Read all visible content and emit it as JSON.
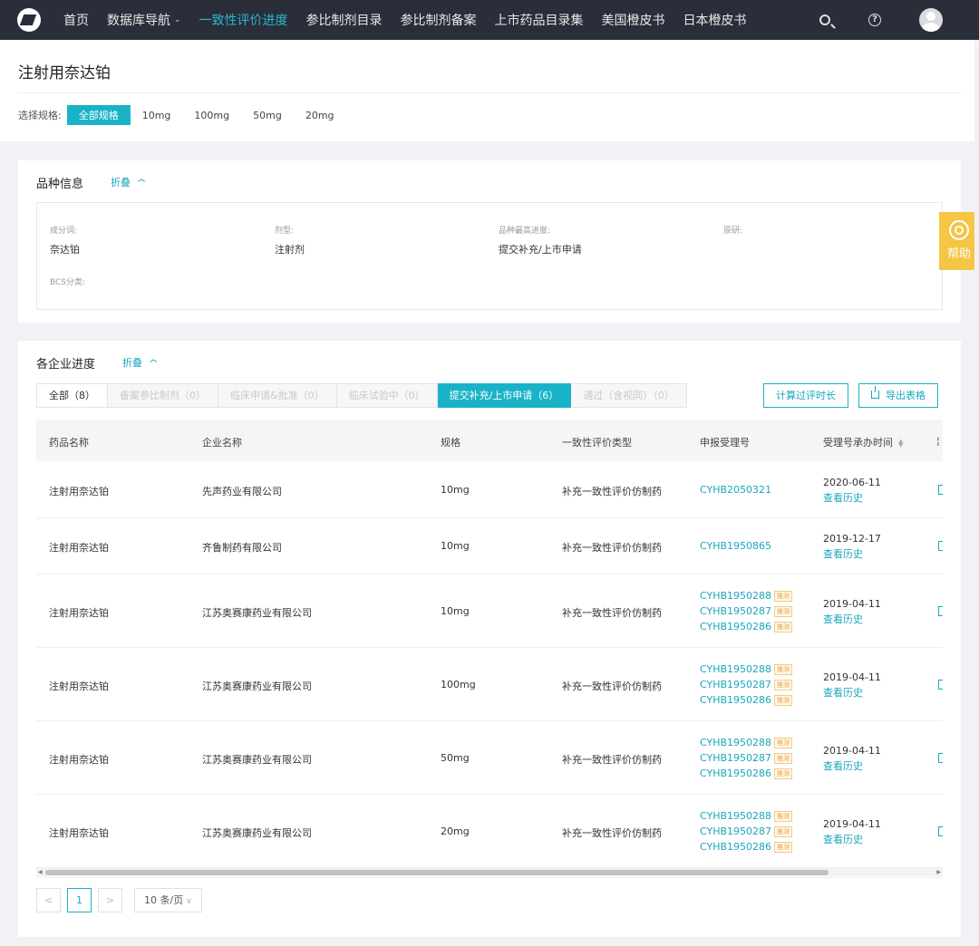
{
  "nav": {
    "items": [
      {
        "label": "首页",
        "active": false
      },
      {
        "label": "数据库导航",
        "active": false,
        "has_dropdown": true
      },
      {
        "label": "一致性评价进度",
        "active": true
      },
      {
        "label": "参比制剂目录",
        "active": false
      },
      {
        "label": "参比制剂备案",
        "active": false
      },
      {
        "label": "上市药品目录集",
        "active": false
      },
      {
        "label": "美国橙皮书",
        "active": false
      },
      {
        "label": "日本橙皮书",
        "active": false
      }
    ],
    "icons": [
      "logo-icon",
      "search-icon",
      "help-icon",
      "user-avatar"
    ]
  },
  "page": {
    "title": "注射用奈达铂",
    "spec_label": "选择规格:",
    "specs": [
      "全部规格",
      "10mg",
      "100mg",
      "50mg",
      "20mg"
    ],
    "active_spec": "全部规格"
  },
  "variety": {
    "title": "品种信息",
    "fold_label": "折叠",
    "fields": [
      {
        "label": "成分词:",
        "value": "奈达铂"
      },
      {
        "label": "剂型:",
        "value": "注射剂"
      },
      {
        "label": "品种最高进度:",
        "value": "提交补充/上市申请"
      },
      {
        "label": "原研:",
        "value": ""
      },
      {
        "label": "BCS分类:",
        "value": ""
      }
    ]
  },
  "enterprise": {
    "title": "各企业进度",
    "fold_label": "折叠",
    "tabs": [
      {
        "label": "全部（8）",
        "active": false
      },
      {
        "label": "备案参比制剂（0）",
        "active": false
      },
      {
        "label": "临床申请&批准（0）",
        "active": false
      },
      {
        "label": "临床试验中（0）",
        "active": false
      },
      {
        "label": "提交补充/上市申请（6）",
        "active": true
      },
      {
        "label": "通过（含视同）（0）",
        "active": false
      }
    ],
    "calc_button": "计算过评时长",
    "export_button": "导出表格",
    "columns": [
      "药品名称",
      "企业名称",
      "规格",
      "一致性评价类型",
      "申报受理号",
      "受理号承办时间"
    ],
    "history_label": "查看历史",
    "tag_label": "推测",
    "rows": [
      {
        "drug": "注射用奈达铂",
        "company": "先声药业有限公司",
        "spec": "10mg",
        "type": "补充一致性评价仿制药",
        "codes": [
          {
            "code": "CYHB2050321",
            "tag": false
          }
        ],
        "date": "2020-06-11"
      },
      {
        "drug": "注射用奈达铂",
        "company": "齐鲁制药有限公司",
        "spec": "10mg",
        "type": "补充一致性评价仿制药",
        "codes": [
          {
            "code": "CYHB1950865",
            "tag": false
          }
        ],
        "date": "2019-12-17"
      },
      {
        "drug": "注射用奈达铂",
        "company": "江苏奥赛康药业有限公司",
        "spec": "10mg",
        "type": "补充一致性评价仿制药",
        "codes": [
          {
            "code": "CYHB1950288",
            "tag": true
          },
          {
            "code": "CYHB1950287",
            "tag": true
          },
          {
            "code": "CYHB1950286",
            "tag": true
          }
        ],
        "date": "2019-04-11"
      },
      {
        "drug": "注射用奈达铂",
        "company": "江苏奥赛康药业有限公司",
        "spec": "100mg",
        "type": "补充一致性评价仿制药",
        "codes": [
          {
            "code": "CYHB1950288",
            "tag": true
          },
          {
            "code": "CYHB1950287",
            "tag": true
          },
          {
            "code": "CYHB1950286",
            "tag": true
          }
        ],
        "date": "2019-04-11"
      },
      {
        "drug": "注射用奈达铂",
        "company": "江苏奥赛康药业有限公司",
        "spec": "50mg",
        "type": "补充一致性评价仿制药",
        "codes": [
          {
            "code": "CYHB1950288",
            "tag": true
          },
          {
            "code": "CYHB1950287",
            "tag": true
          },
          {
            "code": "CYHB1950286",
            "tag": true
          }
        ],
        "date": "2019-04-11"
      },
      {
        "drug": "注射用奈达铂",
        "company": "江苏奥赛康药业有限公司",
        "spec": "20mg",
        "type": "补充一致性评价仿制药",
        "codes": [
          {
            "code": "CYHB1950288",
            "tag": true
          },
          {
            "code": "CYHB1950287",
            "tag": true
          },
          {
            "code": "CYHB1950286",
            "tag": true
          }
        ],
        "date": "2019-04-11"
      }
    ],
    "pagination": {
      "prev": "<",
      "current": "1",
      "next": ">",
      "page_size": "10 条/页"
    }
  },
  "help_float": {
    "label": "帮助"
  },
  "colors": {
    "accent": "#19b3c7",
    "nav_bg": "#2a2e3a",
    "help_bg": "#f5c544",
    "tag": "#e8a23a"
  }
}
